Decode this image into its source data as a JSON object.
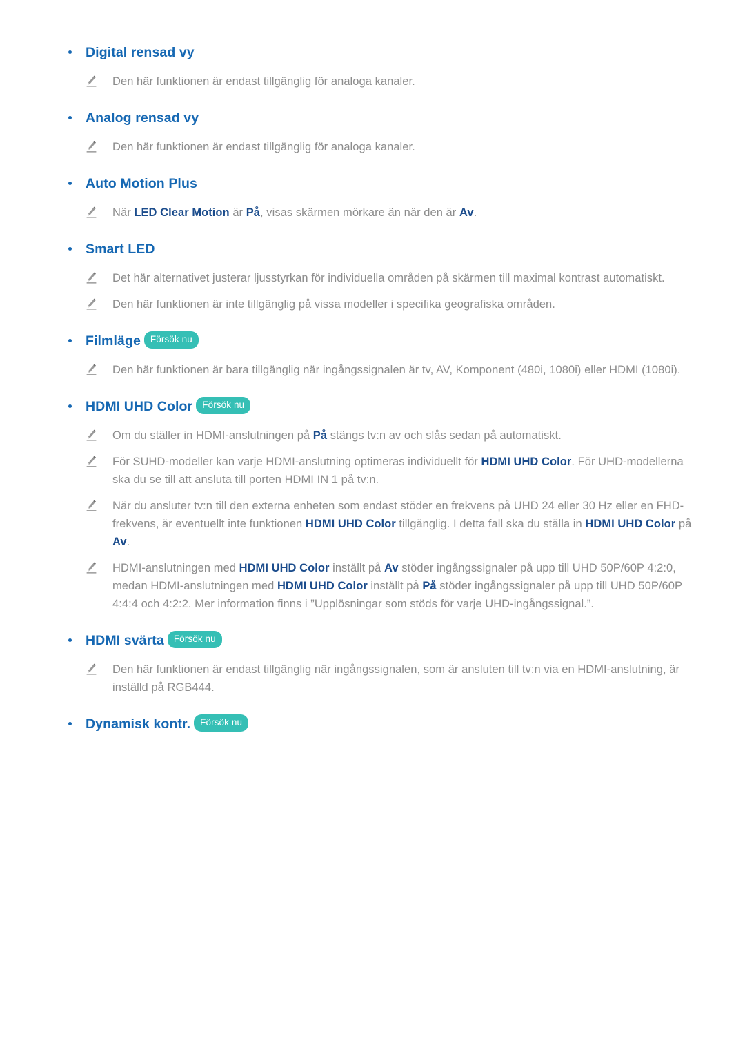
{
  "page": {
    "language": "sv",
    "badge_label": "Försök nu",
    "colors": {
      "heading_blue": "#1668B3",
      "inline_term_blue": "#1B4C8C",
      "body_gray": "#8C8C8C",
      "badge_teal": "#35BFB5",
      "background": "#FFFFFF"
    }
  },
  "features": [
    {
      "id": "digital-rensad-vy",
      "title": "Digital rensad vy",
      "has_badge": false,
      "notes": [
        {
          "segments": [
            {
              "type": "text",
              "value": "Den här funktionen är endast tillgänglig för analoga kanaler."
            }
          ]
        }
      ]
    },
    {
      "id": "analog-rensad-vy",
      "title": "Analog rensad vy",
      "has_badge": false,
      "notes": [
        {
          "segments": [
            {
              "type": "text",
              "value": "Den här funktionen är endast tillgänglig för analoga kanaler."
            }
          ]
        }
      ]
    },
    {
      "id": "auto-motion-plus",
      "title": "Auto Motion Plus",
      "has_badge": false,
      "notes": [
        {
          "segments": [
            {
              "type": "text",
              "value": "När "
            },
            {
              "type": "term",
              "value": "LED Clear Motion"
            },
            {
              "type": "text",
              "value": " är "
            },
            {
              "type": "term",
              "value": "På"
            },
            {
              "type": "text",
              "value": ", visas skärmen mörkare än när den är "
            },
            {
              "type": "term",
              "value": "Av"
            },
            {
              "type": "text",
              "value": "."
            }
          ]
        }
      ]
    },
    {
      "id": "smart-led",
      "title": "Smart LED",
      "has_badge": false,
      "notes": [
        {
          "segments": [
            {
              "type": "text",
              "value": "Det här alternativet justerar ljusstyrkan för individuella områden på skärmen till maximal kontrast automatiskt."
            }
          ]
        },
        {
          "segments": [
            {
              "type": "text",
              "value": "Den här funktionen är inte tillgänglig på vissa modeller i specifika geografiska områden."
            }
          ]
        }
      ]
    },
    {
      "id": "filmlage",
      "title": "Filmläge",
      "has_badge": true,
      "notes": [
        {
          "segments": [
            {
              "type": "text",
              "value": "Den här funktionen är bara tillgänglig när ingångssignalen är tv, AV, Komponent (480i, 1080i) eller HDMI (1080i)."
            }
          ]
        }
      ]
    },
    {
      "id": "hdmi-uhd-color",
      "title": "HDMI UHD Color",
      "has_badge": true,
      "notes": [
        {
          "segments": [
            {
              "type": "text",
              "value": "Om du ställer in HDMI-anslutningen på "
            },
            {
              "type": "term",
              "value": "På"
            },
            {
              "type": "text",
              "value": " stängs tv:n av och slås sedan på automatiskt."
            }
          ]
        },
        {
          "segments": [
            {
              "type": "text",
              "value": "För SUHD-modeller kan varje HDMI-anslutning optimeras individuellt för "
            },
            {
              "type": "term",
              "value": "HDMI UHD Color"
            },
            {
              "type": "text",
              "value": ". För UHD-modellerna ska du se till att ansluta till porten HDMI IN 1 på tv:n."
            }
          ]
        },
        {
          "segments": [
            {
              "type": "text",
              "value": "När du ansluter tv:n till den externa enheten som endast stöder en frekvens på UHD 24 eller 30 Hz eller en FHD-frekvens, är eventuellt inte funktionen "
            },
            {
              "type": "term",
              "value": "HDMI UHD Color"
            },
            {
              "type": "text",
              "value": " tillgänglig. I detta fall ska du ställa in "
            },
            {
              "type": "term",
              "value": "HDMI UHD Color"
            },
            {
              "type": "text",
              "value": " på "
            },
            {
              "type": "term",
              "value": "Av"
            },
            {
              "type": "text",
              "value": "."
            }
          ]
        },
        {
          "segments": [
            {
              "type": "text",
              "value": "HDMI-anslutningen med "
            },
            {
              "type": "term",
              "value": "HDMI UHD Color"
            },
            {
              "type": "text",
              "value": " inställt på "
            },
            {
              "type": "term",
              "value": "Av"
            },
            {
              "type": "text",
              "value": " stöder ingångssignaler på upp till UHD 50P/60P 4:2:0, medan HDMI-anslutningen med "
            },
            {
              "type": "term",
              "value": "HDMI UHD Color"
            },
            {
              "type": "text",
              "value": " inställt på "
            },
            {
              "type": "term",
              "value": "På"
            },
            {
              "type": "text",
              "value": " stöder ingångssignaler på upp till UHD 50P/60P 4:4:4 och 4:2:2. Mer information finns i ”"
            },
            {
              "type": "link",
              "value": "Upplösningar som stöds för varje UHD-ingångssignal."
            },
            {
              "type": "text",
              "value": "”."
            }
          ]
        }
      ]
    },
    {
      "id": "hdmi-svarta",
      "title": "HDMI svärta",
      "has_badge": true,
      "notes": [
        {
          "segments": [
            {
              "type": "text",
              "value": "Den här funktionen är endast tillgänglig när ingångssignalen, som är ansluten till tv:n via en HDMI-anslutning, är inställd på RGB444."
            }
          ]
        }
      ]
    },
    {
      "id": "dynamisk-kontr",
      "title": "Dynamisk kontr.",
      "has_badge": true,
      "notes": []
    }
  ]
}
